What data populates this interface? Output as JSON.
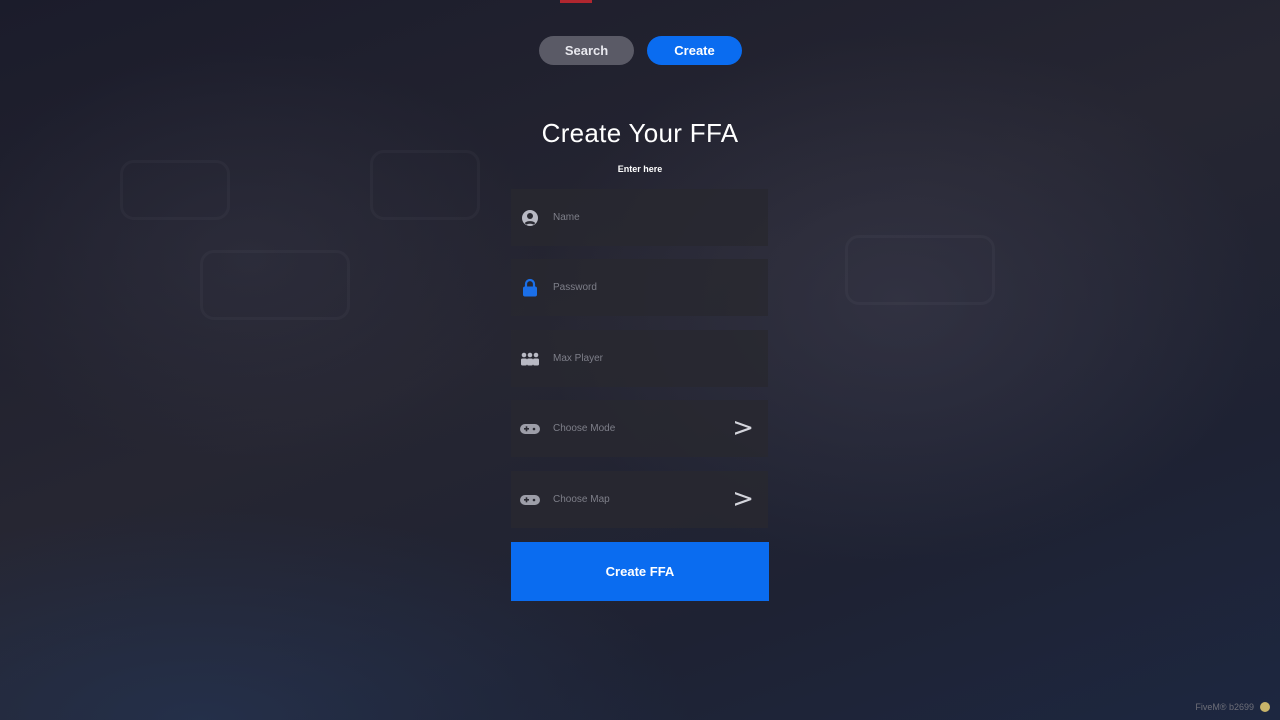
{
  "nav": {
    "search_label": "Search",
    "create_label": "Create"
  },
  "form": {
    "title": "Create Your FFA",
    "subtitle": "Enter here",
    "fields": [
      {
        "icon": "user-icon",
        "placeholder": "Name"
      },
      {
        "icon": "lock-icon",
        "placeholder": "Password"
      },
      {
        "icon": "players-icon",
        "placeholder": "Max Player"
      },
      {
        "icon": "gamepad-icon",
        "placeholder": "Choose Mode",
        "chevron": ">"
      },
      {
        "icon": "gamepad-icon",
        "placeholder": "Choose Map",
        "chevron": ">"
      }
    ],
    "submit_label": "Create FFA"
  },
  "footer": {
    "text": "FiveM® b2699"
  },
  "colors": {
    "accent": "#0a6cf0",
    "search_button": "#5a5a66",
    "field_bg": "#28282f",
    "top_mark": "#b0262f"
  }
}
